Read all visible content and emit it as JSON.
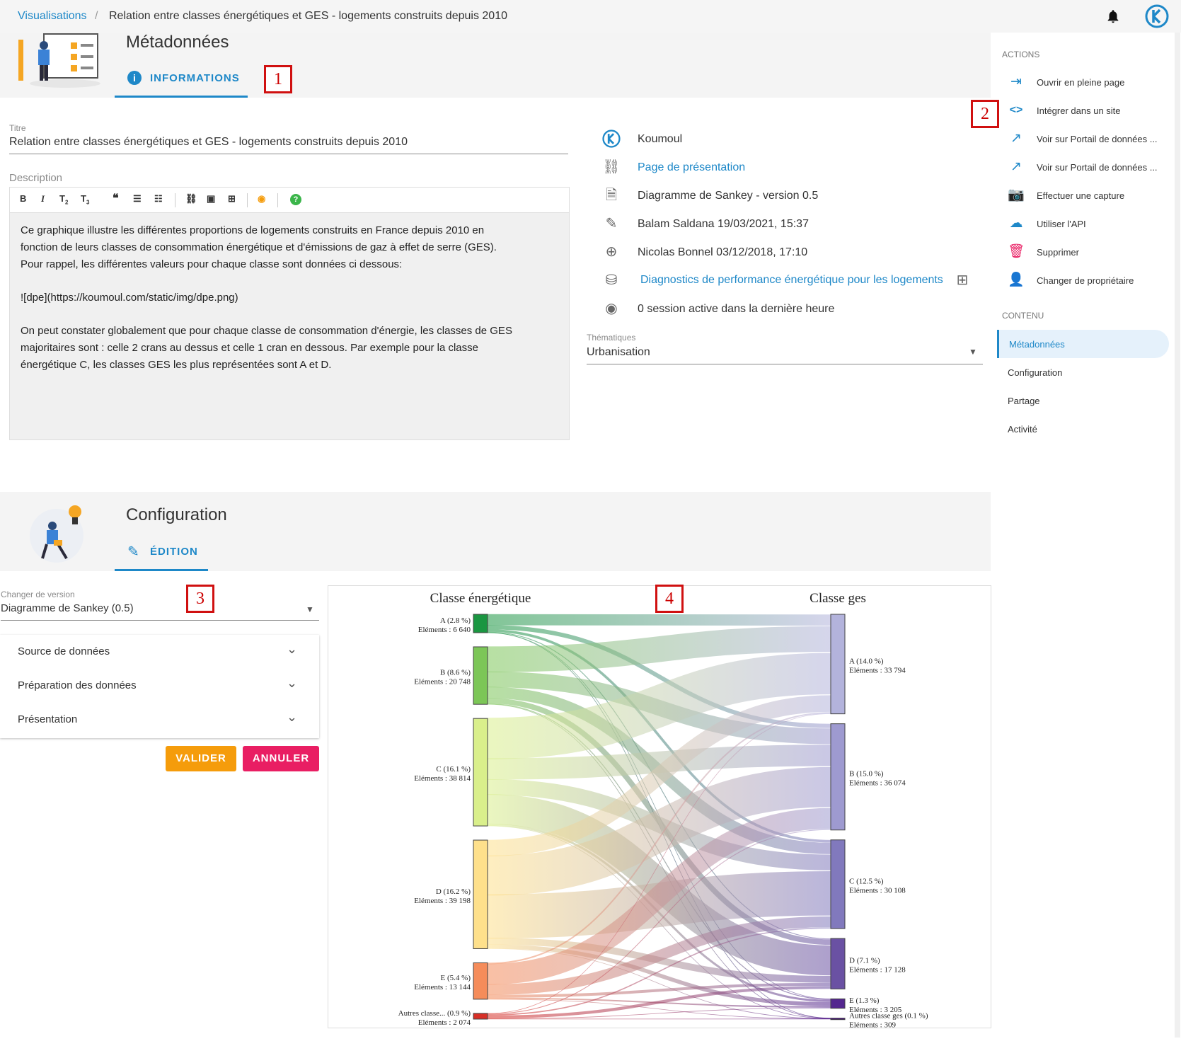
{
  "breadcrumb": {
    "link": "Visualisations",
    "separator": "/",
    "current": "Relation entre classes énergétiques et GES - logements construits depuis 2010"
  },
  "metadata_section": {
    "title": "Métadonnées",
    "tab": "INFORMATIONS",
    "marker": "1",
    "title_label": "Titre",
    "title_value": "Relation entre classes énergétiques et GES - logements construits depuis 2010",
    "description_label": "Description",
    "description_lines": [
      "Ce graphique illustre les différentes proportions de logements construits en France depuis 2010 en",
      "fonction de leurs classes de consommation énergétique et d'émissions de gaz à effet de serre (GES).",
      "Pour rappel, les différentes valeurs pour chaque classe sont données ci dessous:",
      "![dpe](https://koumoul.com/static/img/dpe.png)",
      "On peut constater globalement que pour chaque classe de consommation d'énergie, les classes de GES",
      "majoritaires sont : celle 2 crans au dessus et celle 1 cran en dessous. Par exemple pour la classe",
      "énergétique C, les classes GES les plus représentées sont A et D."
    ],
    "info": {
      "owner": "Koumoul",
      "presentation_link": "Page de présentation",
      "type": "Diagramme de Sankey - version 0.5",
      "updated": "Balam Saldana 19/03/2021, 15:37",
      "created": "Nicolas Bonnel 03/12/2018, 17:10",
      "dataset": "Diagnostics de performance énergétique pour les logements",
      "sessions": "0 session active dans la dernière heure"
    },
    "topics_label": "Thématiques",
    "topics_value": "Urbanisation"
  },
  "actions": {
    "heading": "ACTIONS",
    "marker": "2",
    "items": [
      "Ouvrir en pleine page",
      "Intégrer dans un site",
      "Voir sur Portail de données ...",
      "Voir sur Portail de données ...",
      "Effectuer une capture",
      "Utiliser l'API",
      "Supprimer",
      "Changer de propriétaire"
    ]
  },
  "content_nav": {
    "heading": "CONTENU",
    "items": [
      "Métadonnées",
      "Configuration",
      "Partage",
      "Activité"
    ]
  },
  "config_section": {
    "title": "Configuration",
    "tab": "ÉDITION",
    "version_label": "Changer de version",
    "version_value": "Diagramme de Sankey (0.5)",
    "marker_left": "3",
    "marker_chart": "4",
    "panels": [
      "Source de données",
      "Préparation des données",
      "Présentation"
    ],
    "validate": "VALIDER",
    "cancel": "ANNULER"
  },
  "colors": {
    "accent": "#1e88c8",
    "validate": "#f59c0b",
    "cancel": "#e91e63",
    "delete": "#e91e63"
  },
  "chart_data": {
    "type": "sankey",
    "left_title": "Classe énergétique",
    "right_title": "Classe ges",
    "sources": [
      {
        "name": "A (2.8 %)",
        "count": "Eléments : 6 640",
        "value": 6640,
        "color": "#1a9641"
      },
      {
        "name": "B (8.6 %)",
        "count": "Eléments : 20 748",
        "value": 20748,
        "color": "#7cc657"
      },
      {
        "name": "C (16.1 %)",
        "count": "Eléments : 38 814",
        "value": 38814,
        "color": "#d9ef8b"
      },
      {
        "name": "D (16.2 %)",
        "count": "Eléments : 39 198",
        "value": 39198,
        "color": "#fee08b"
      },
      {
        "name": "E (5.4 %)",
        "count": "Eléments : 13 144",
        "value": 13144,
        "color": "#f58c5a"
      },
      {
        "name": "Autres classe... (0.9 %)",
        "count": "Eléments : 2 074",
        "value": 2074,
        "color": "#d73027"
      }
    ],
    "targets": [
      {
        "name": "A (14.0 %)",
        "count": "Eléments : 33 794",
        "value": 33794,
        "color": "#b3b3dc"
      },
      {
        "name": "B (15.0 %)",
        "count": "Eléments : 36 074",
        "value": 36074,
        "color": "#9e9ad0"
      },
      {
        "name": "C (12.5 %)",
        "count": "Eléments : 30 108",
        "value": 30108,
        "color": "#8179bd"
      },
      {
        "name": "D (7.1 %)",
        "count": "Eléments : 17 128",
        "value": 17128,
        "color": "#6a51a3"
      },
      {
        "name": "E (1.3 %)",
        "count": "Eléments : 3 205",
        "value": 3205,
        "color": "#54278f"
      },
      {
        "name": "Autres classe ges (0.1 %)",
        "count": "Eléments : 309",
        "value": 309,
        "color": "#3f007d"
      }
    ],
    "links": [
      {
        "source": 0,
        "target": 0,
        "value": 3900
      },
      {
        "source": 0,
        "target": 1,
        "value": 1500
      },
      {
        "source": 0,
        "target": 2,
        "value": 900
      },
      {
        "source": 0,
        "target": 3,
        "value": 280
      },
      {
        "source": 0,
        "target": 4,
        "value": 50
      },
      {
        "source": 0,
        "target": 5,
        "value": 10
      },
      {
        "source": 1,
        "target": 0,
        "value": 9000
      },
      {
        "source": 1,
        "target": 1,
        "value": 5500
      },
      {
        "source": 1,
        "target": 2,
        "value": 4000
      },
      {
        "source": 1,
        "target": 3,
        "value": 1900
      },
      {
        "source": 1,
        "target": 4,
        "value": 300
      },
      {
        "source": 1,
        "target": 5,
        "value": 48
      },
      {
        "source": 2,
        "target": 0,
        "value": 14500
      },
      {
        "source": 2,
        "target": 1,
        "value": 7500
      },
      {
        "source": 2,
        "target": 2,
        "value": 5500
      },
      {
        "source": 2,
        "target": 3,
        "value": 10500
      },
      {
        "source": 2,
        "target": 4,
        "value": 750
      },
      {
        "source": 2,
        "target": 5,
        "value": 64
      },
      {
        "source": 3,
        "target": 0,
        "value": 5800
      },
      {
        "source": 3,
        "target": 1,
        "value": 14000
      },
      {
        "source": 3,
        "target": 2,
        "value": 15500
      },
      {
        "source": 3,
        "target": 3,
        "value": 2400
      },
      {
        "source": 3,
        "target": 4,
        "value": 1400
      },
      {
        "source": 3,
        "target": 5,
        "value": 98
      },
      {
        "source": 4,
        "target": 0,
        "value": 500
      },
      {
        "source": 4,
        "target": 1,
        "value": 7300
      },
      {
        "source": 4,
        "target": 2,
        "value": 3800
      },
      {
        "source": 4,
        "target": 3,
        "value": 1000
      },
      {
        "source": 4,
        "target": 4,
        "value": 500
      },
      {
        "source": 4,
        "target": 5,
        "value": 44
      },
      {
        "source": 5,
        "target": 0,
        "value": 94
      },
      {
        "source": 5,
        "target": 1,
        "value": 274
      },
      {
        "source": 5,
        "target": 2,
        "value": 408
      },
      {
        "source": 5,
        "target": 3,
        "value": 1048
      },
      {
        "source": 5,
        "target": 4,
        "value": 205
      },
      {
        "source": 5,
        "target": 5,
        "value": 45
      }
    ]
  }
}
